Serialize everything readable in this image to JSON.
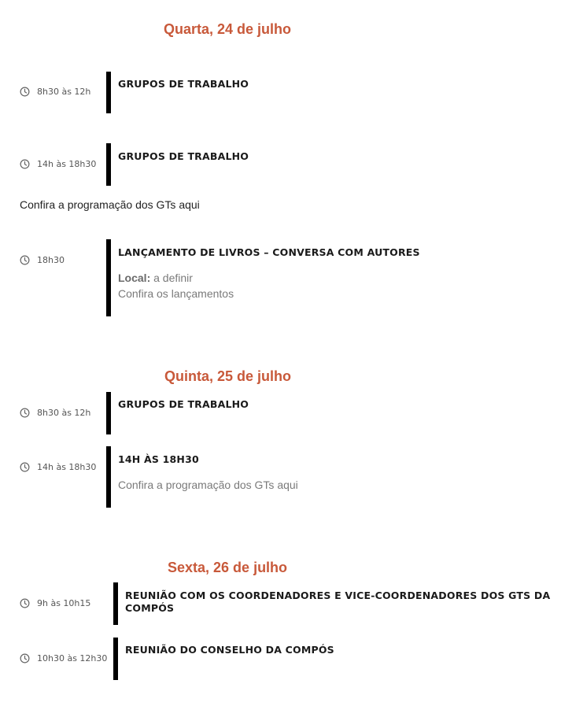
{
  "days": [
    {
      "title": "Quarta, 24 de julho",
      "events": [
        {
          "time": "8h30 às 12h",
          "title": "GRUPOS DE TRABALHO"
        },
        {
          "time": "14h às 18h30",
          "title": "GRUPOS DE TRABALHO"
        },
        {
          "time": "18h30",
          "title": "LANÇAMENTO DE LIVROS – CONVERSA COM AUTORES",
          "location_label": "Local:",
          "location_value": "a definir",
          "link": "Confira os lançamentos"
        }
      ],
      "gts_link": "Confira a programação dos GTs aqui"
    },
    {
      "title": "Quinta, 25 de julho",
      "events": [
        {
          "time": "8h30 às 12h",
          "title": "GRUPOS DE TRABALHO"
        },
        {
          "time": "14h às 18h30",
          "title": "14H ÀS 18H30",
          "link": "Confira a programação dos GTs aqui"
        }
      ]
    },
    {
      "title": "Sexta, 26 de julho",
      "events": [
        {
          "time": "9h às 10h15",
          "title": "REUNIÃO COM OS COORDENADORES E VICE-COORDENADORES DOS GTS DA COMPÓS"
        },
        {
          "time": "10h30 às 12h30",
          "title": "REUNIÃO DO CONSELHO DA COMPÓS"
        }
      ]
    }
  ],
  "icons": {
    "time": "clock-icon"
  },
  "colors": {
    "day_title": "#c8593a",
    "bar": "#000000",
    "detail": "#7a7a7a"
  }
}
